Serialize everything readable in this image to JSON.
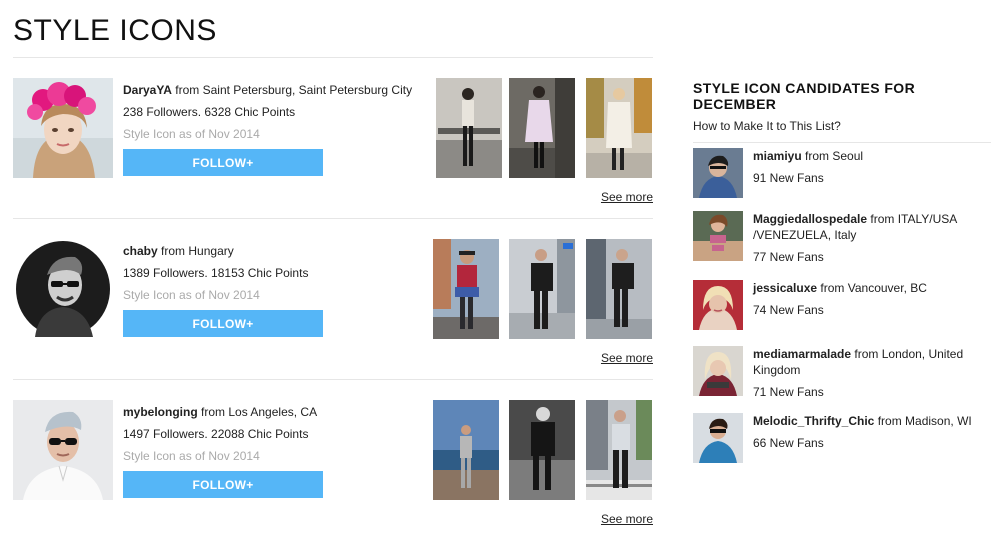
{
  "page": {
    "title": "STYLE ICONS"
  },
  "icons": [
    {
      "username": "DaryaYA",
      "from_word": "from",
      "location": "Saint Petersburg, Saint Petersburg City",
      "stats": "238 Followers. 6328 Chic Points",
      "since": "Style Icon as of Nov 2014",
      "follow_label": "FOLLOW+",
      "see_more": "See more"
    },
    {
      "username": "chaby",
      "from_word": "from",
      "location": "Hungary",
      "stats": "1389 Followers. 18153 Chic Points",
      "since": "Style Icon as of Nov 2014",
      "follow_label": "FOLLOW+",
      "see_more": "See more"
    },
    {
      "username": "mybelonging",
      "from_word": "from",
      "location": "Los Angeles, CA",
      "stats": "1497 Followers. 22088 Chic Points",
      "since": "Style Icon as of Nov 2014",
      "follow_label": "FOLLOW+",
      "see_more": "See more"
    }
  ],
  "sidebar": {
    "title": "STYLE ICON CANDIDATES FOR DECEMBER",
    "link": "How to Make It to This List?",
    "candidates": [
      {
        "username": "miamiyu",
        "from_word": "from",
        "location": "Seoul",
        "fans": "91 New Fans"
      },
      {
        "username": "Maggiedallospedale",
        "from_word": "from",
        "location": "ITALY/USA /VENEZUELA, Italy",
        "fans": "77 New Fans"
      },
      {
        "username": "jessicaluxe",
        "from_word": "from",
        "location": "Vancouver, BC",
        "fans": "74 New Fans"
      },
      {
        "username": "mediamarmalade",
        "from_word": "from",
        "location": "London, United Kingdom",
        "fans": "71 New Fans"
      },
      {
        "username": "Melodic_Thrifty_Chic",
        "from_word": "from",
        "location": "Madison, WI",
        "fans": "66 New Fans"
      }
    ]
  },
  "colors": {
    "accent": "#55b6f7",
    "muted": "#aaaaaa",
    "rule": "#e6e6e6"
  }
}
